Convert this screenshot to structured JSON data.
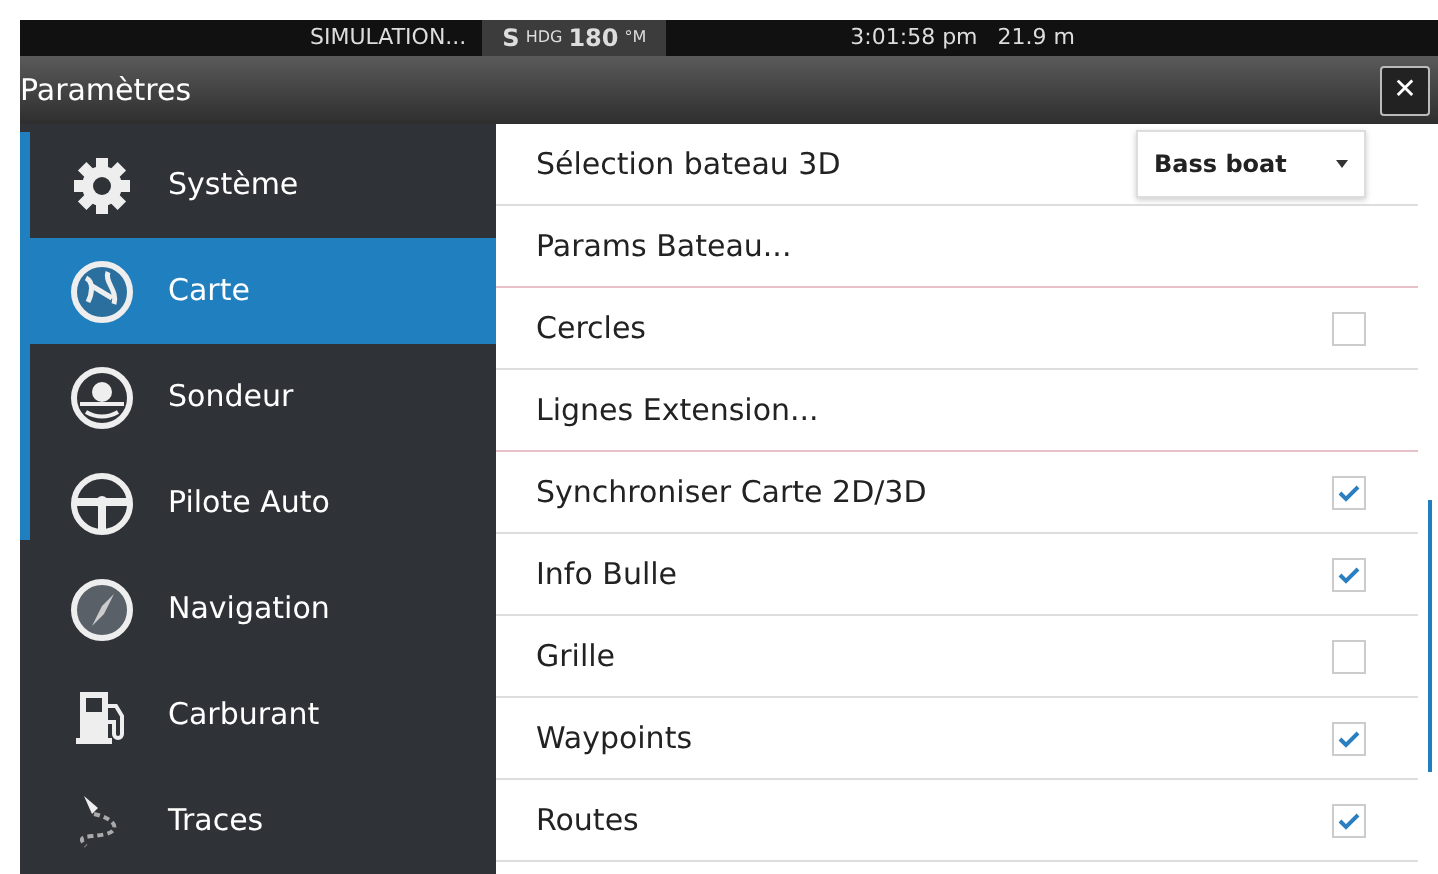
{
  "status_bar": {
    "mode": "SIMULATION...",
    "heading_prefix": "S",
    "heading_label": "HDG",
    "heading_value": "180",
    "heading_unit": "°M",
    "time": "3:01:58 pm",
    "depth": "21.9 m"
  },
  "window": {
    "title": "Paramètres",
    "close": "✕"
  },
  "sidebar": {
    "items": [
      {
        "label": "Système",
        "selected": false
      },
      {
        "label": "Carte",
        "selected": true
      },
      {
        "label": "Sondeur",
        "selected": false
      },
      {
        "label": "Pilote Auto",
        "selected": false
      },
      {
        "label": "Navigation",
        "selected": false
      },
      {
        "label": "Carburant",
        "selected": false
      },
      {
        "label": "Traces",
        "selected": false
      }
    ]
  },
  "settings": [
    {
      "kind": "dropdown",
      "label": "Sélection bateau 3D",
      "value": "Bass boat"
    },
    {
      "kind": "link",
      "label": "Params Bateau..."
    },
    {
      "kind": "checkbox",
      "label": "Cercles",
      "checked": false
    },
    {
      "kind": "link",
      "label": "Lignes Extension..."
    },
    {
      "kind": "checkbox",
      "label": "Synchroniser Carte 2D/3D",
      "checked": true
    },
    {
      "kind": "checkbox",
      "label": "Info Bulle",
      "checked": true
    },
    {
      "kind": "checkbox",
      "label": "Grille",
      "checked": false
    },
    {
      "kind": "checkbox",
      "label": "Waypoints",
      "checked": true
    },
    {
      "kind": "checkbox",
      "label": "Routes",
      "checked": true
    }
  ]
}
